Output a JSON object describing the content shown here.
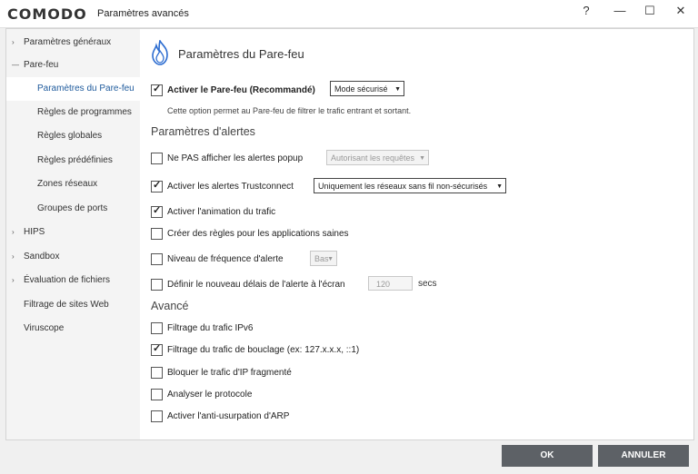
{
  "titlebar": {
    "logo": "COMODO",
    "title": "Paramètres avancés",
    "help": "?",
    "minimize": "—",
    "maximize": "☐",
    "close": "✕"
  },
  "sidebar": {
    "items": [
      {
        "label": "Paramètres généraux",
        "arrow": "›"
      },
      {
        "label": "Pare-feu",
        "arrow": "—"
      },
      {
        "label": "Paramètres du Pare-feu"
      },
      {
        "label": "Règles de programmes"
      },
      {
        "label": "Règles globales"
      },
      {
        "label": "Règles prédéfinies"
      },
      {
        "label": "Zones réseaux"
      },
      {
        "label": "Groupes de ports"
      },
      {
        "label": "HIPS",
        "arrow": "›"
      },
      {
        "label": "Sandbox",
        "arrow": "›"
      },
      {
        "label": "Évaluation de fichiers",
        "arrow": "›"
      },
      {
        "label": "Filtrage de sites Web"
      },
      {
        "label": "Viruscope"
      }
    ]
  },
  "content": {
    "title": "Paramètres du Pare-feu",
    "enable_firewall": {
      "label": "Activer le Pare-feu (Recommandé)",
      "checked": true,
      "mode": "Mode sécurisé"
    },
    "description": "Cette option permet au Pare-feu de filtrer le trafic entrant et sortant.",
    "alerts_section": "Paramètres d'alertes",
    "alerts": [
      {
        "label": "Ne PAS afficher les alertes popup",
        "checked": false,
        "dropdown": "Autorisant les requêtes"
      },
      {
        "label": "Activer les alertes Trustconnect",
        "checked": true,
        "dropdown": "Uniquement les réseaux sans fil non-sécurisés"
      },
      {
        "label": "Activer l'animation du trafic",
        "checked": true
      },
      {
        "label": "Créer des règles pour les applications saines",
        "checked": false
      },
      {
        "label": "Niveau de fréquence d'alerte",
        "checked": false,
        "dropdown": "Bas"
      },
      {
        "label": "Définir le nouveau délais de l'alerte à l'écran",
        "checked": false,
        "value": "120",
        "suffix": "secs"
      }
    ],
    "advanced_section": "Avancé",
    "advanced": [
      {
        "label": "Filtrage du trafic IPv6",
        "checked": false
      },
      {
        "label": "Filtrage du trafic de bouclage (ex: 127.x.x.x, ::1)",
        "checked": true
      },
      {
        "label": "Bloquer le trafic d'IP fragmenté",
        "checked": false
      },
      {
        "label": "Analyser le protocole",
        "checked": false
      },
      {
        "label": "Activer l'anti-usurpation d'ARP",
        "checked": false
      }
    ]
  },
  "buttons": {
    "ok": "OK",
    "cancel": "ANNULER"
  },
  "check_glyph": "✓",
  "caret_glyph": "▼"
}
